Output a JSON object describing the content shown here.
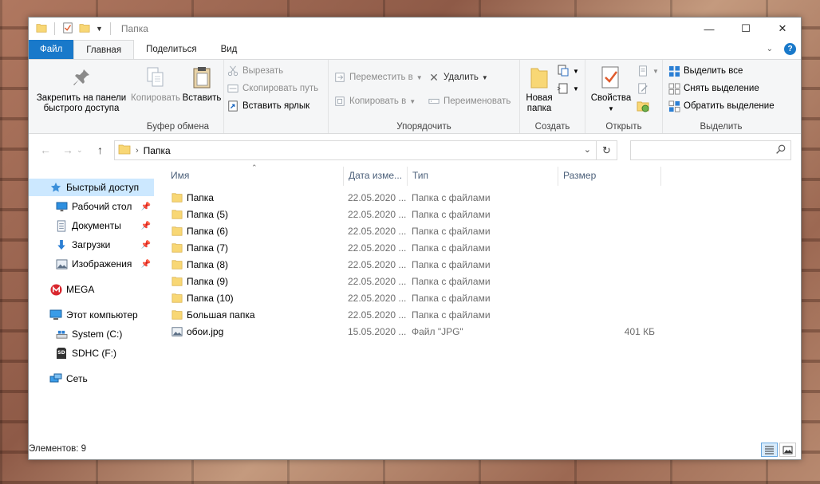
{
  "window": {
    "title": "Папка",
    "controls": [
      "minimize",
      "maximize",
      "close"
    ]
  },
  "tabs": [
    {
      "label": "Файл"
    },
    {
      "label": "Главная"
    },
    {
      "label": "Поделиться"
    },
    {
      "label": "Вид"
    }
  ],
  "ribbon": {
    "clipboard": {
      "label": "Буфер обмена",
      "pin_label": "Закрепить на панели быстрого доступа",
      "pin_line1": "Закрепить на панели",
      "pin_line2": "быстрого доступа",
      "copy_label": "Копировать",
      "paste_label": "Вставить",
      "cut_label": "Вырезать",
      "copy_path_label": "Скопировать путь",
      "paste_shortcut_label": "Вставить ярлык"
    },
    "organize": {
      "label": "Упорядочить",
      "move_to_label": "Переместить в",
      "copy_to_label": "Копировать в",
      "delete_label": "Удалить",
      "rename_label": "Переименовать"
    },
    "create": {
      "label": "Создать",
      "new_folder_line1": "Новая",
      "new_folder_line2": "папка"
    },
    "open": {
      "label": "Открыть",
      "properties_label": "Свойства"
    },
    "select": {
      "label": "Выделить",
      "select_all_label": "Выделить все",
      "select_none_label": "Снять выделение",
      "invert_label": "Обратить выделение"
    }
  },
  "address": {
    "path": "Папка",
    "search_placeholder": ""
  },
  "sidebar": {
    "items": [
      {
        "label": "Быстрый доступ",
        "icon": "star-icon",
        "selected": true,
        "pinned": false
      },
      {
        "label": "Рабочий стол",
        "icon": "desktop-icon",
        "selected": false,
        "pinned": true
      },
      {
        "label": "Документы",
        "icon": "documents-icon",
        "selected": false,
        "pinned": true
      },
      {
        "label": "Загрузки",
        "icon": "download-icon",
        "selected": false,
        "pinned": true
      },
      {
        "label": "Изображения",
        "icon": "pictures-icon",
        "selected": false,
        "pinned": true
      },
      {
        "label": "MEGA",
        "icon": "mega-icon",
        "selected": false,
        "pinned": false
      },
      {
        "label": "Этот компьютер",
        "icon": "computer-icon",
        "selected": false,
        "pinned": false
      },
      {
        "label": "System (C:)",
        "icon": "drive-icon",
        "selected": false,
        "pinned": false
      },
      {
        "label": "SDHC (F:)",
        "icon": "sd-card-icon",
        "selected": false,
        "pinned": false
      },
      {
        "label": "Сеть",
        "icon": "network-icon",
        "selected": false,
        "pinned": false
      }
    ]
  },
  "files": {
    "columns": [
      "Имя",
      "Дата изме...",
      "Тип",
      "Размер"
    ],
    "rows": [
      {
        "name": "Папка",
        "date": "22.05.2020 ...",
        "type": "Папка с файлами",
        "size": "",
        "icon": "folder-icon"
      },
      {
        "name": "Папка (5)",
        "date": "22.05.2020 ...",
        "type": "Папка с файлами",
        "size": "",
        "icon": "folder-icon"
      },
      {
        "name": "Папка (6)",
        "date": "22.05.2020 ...",
        "type": "Папка с файлами",
        "size": "",
        "icon": "folder-icon"
      },
      {
        "name": "Папка (7)",
        "date": "22.05.2020 ...",
        "type": "Папка с файлами",
        "size": "",
        "icon": "folder-icon"
      },
      {
        "name": "Папка (8)",
        "date": "22.05.2020 ...",
        "type": "Папка с файлами",
        "size": "",
        "icon": "folder-icon"
      },
      {
        "name": "Папка (9)",
        "date": "22.05.2020 ...",
        "type": "Папка с файлами",
        "size": "",
        "icon": "folder-icon"
      },
      {
        "name": "Папка (10)",
        "date": "22.05.2020 ...",
        "type": "Папка с файлами",
        "size": "",
        "icon": "folder-icon"
      },
      {
        "name": "Большая папка",
        "date": "22.05.2020 ...",
        "type": "Папка с файлами",
        "size": "",
        "icon": "folder-icon"
      },
      {
        "name": "обои.jpg",
        "date": "15.05.2020 ...",
        "type": "Файл \"JPG\"",
        "size": "401 КБ",
        "icon": "image-file-icon"
      }
    ]
  },
  "status": {
    "count_text": "Элементов: 9"
  },
  "colors": {
    "accent": "#1979ca",
    "selection": "#cce8ff",
    "folder": "#f8d775"
  }
}
